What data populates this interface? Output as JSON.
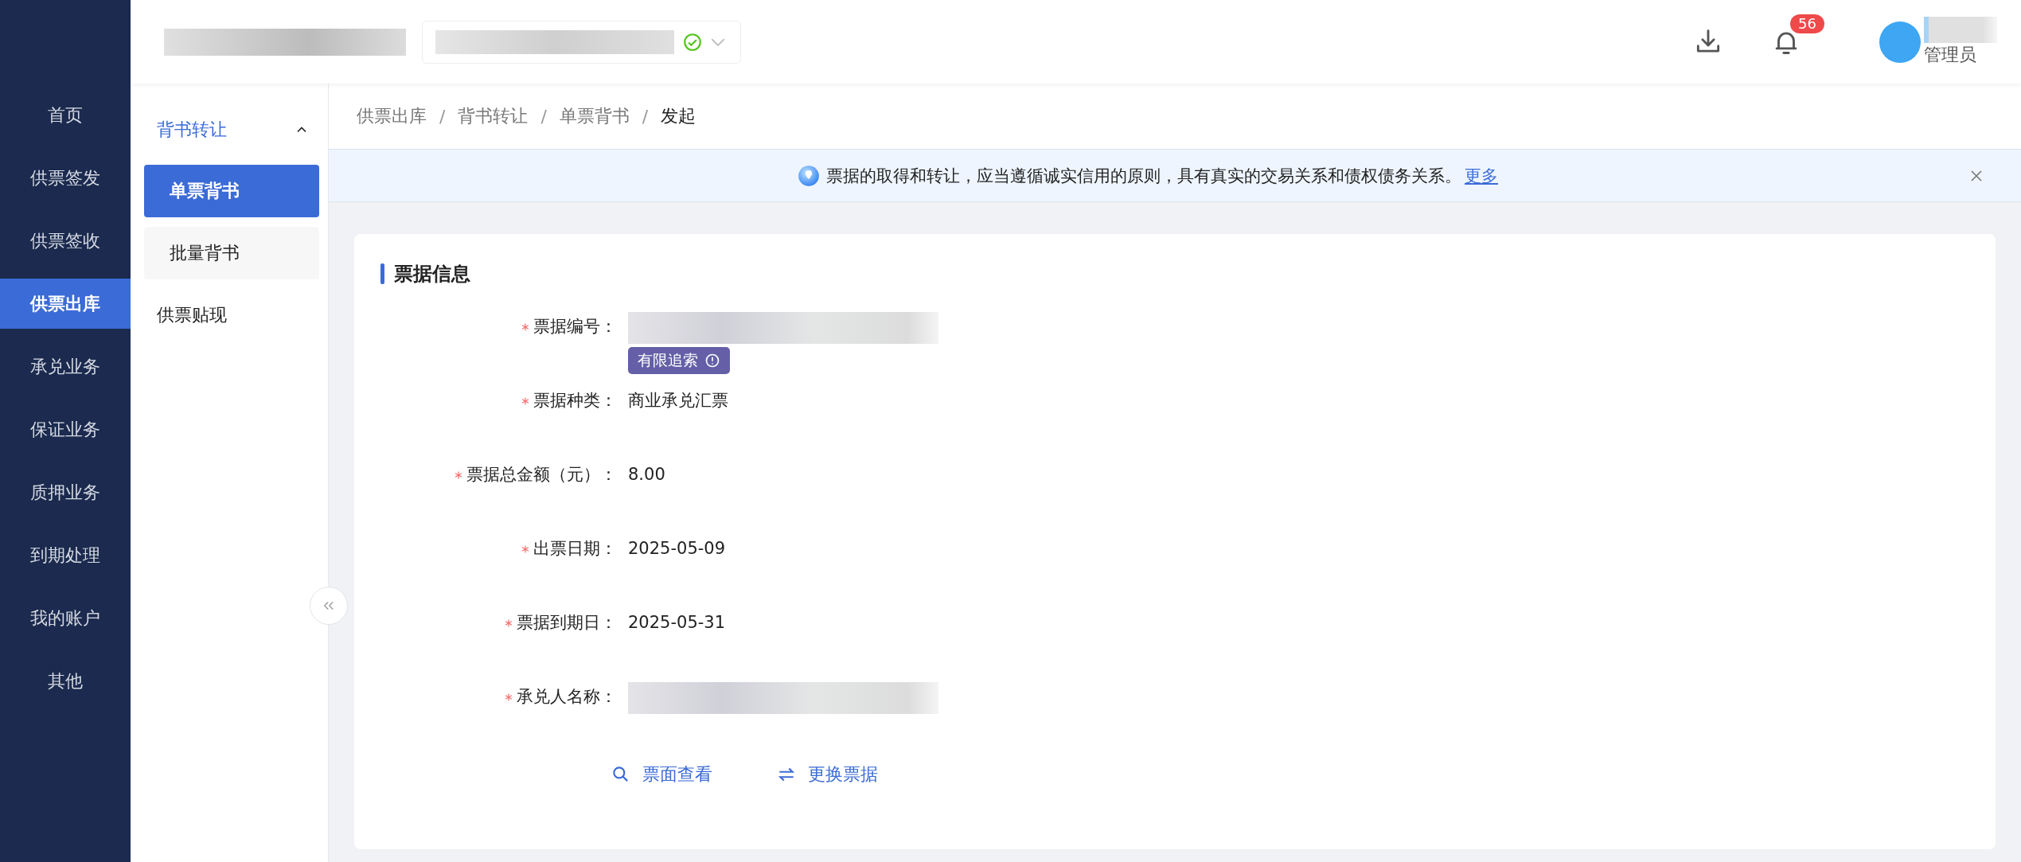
{
  "nav": {
    "items": [
      {
        "label": "首页",
        "selected": false
      },
      {
        "label": "供票签发",
        "selected": false
      },
      {
        "label": "供票签收",
        "selected": false
      },
      {
        "label": "供票出库",
        "selected": true
      },
      {
        "label": "承兑业务",
        "selected": false
      },
      {
        "label": "保证业务",
        "selected": false
      },
      {
        "label": "质押业务",
        "selected": false
      },
      {
        "label": "到期处理",
        "selected": false
      },
      {
        "label": "我的账户",
        "selected": false
      },
      {
        "label": "其他",
        "selected": false
      }
    ]
  },
  "header": {
    "org_selector": {
      "verified": true
    },
    "notification_count": "56",
    "user": {
      "role": "管理员"
    }
  },
  "submenu": {
    "items": [
      {
        "kind": "group",
        "label": "背书转让",
        "expanded": true,
        "children": [
          {
            "label": "单票背书",
            "selected": true
          },
          {
            "label": "批量背书",
            "selected": false
          }
        ]
      },
      {
        "kind": "link",
        "label": "供票贴现",
        "selected": false
      }
    ]
  },
  "breadcrumb": {
    "separator": "/",
    "items": [
      "供票出库",
      "背书转让",
      "单票背书",
      "发起"
    ]
  },
  "notice": {
    "text": "票据的取得和转让，应当遵循诚实信用的原则，具有真实的交易关系和债权债务关系。",
    "link": "更多"
  },
  "card": {
    "title": "票据信息",
    "fields": [
      {
        "label": "票据编号：",
        "required": true,
        "kind": "masked",
        "tag": "有限追索"
      },
      {
        "label": "票据种类：",
        "required": true,
        "kind": "text",
        "value": "商业承兑汇票"
      },
      {
        "label": "票据总金额（元）：",
        "required": true,
        "kind": "text",
        "value": "8.00"
      },
      {
        "label": "出票日期：",
        "required": true,
        "kind": "text",
        "value": "2025-05-09"
      },
      {
        "label": "票据到期日：",
        "required": true,
        "kind": "text",
        "value": "2025-05-31"
      },
      {
        "label": "承兑人名称：",
        "required": true,
        "kind": "masked"
      }
    ],
    "actions": [
      {
        "kind": "search",
        "label": "票面查看"
      },
      {
        "kind": "swap",
        "label": "更换票据"
      }
    ]
  }
}
